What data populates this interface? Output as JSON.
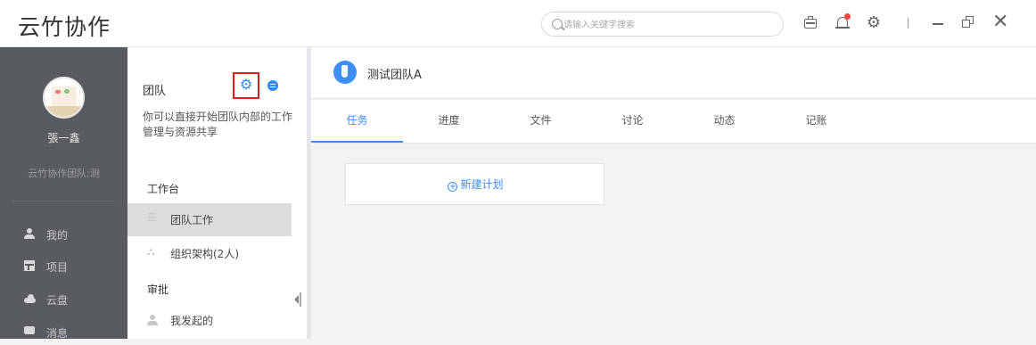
{
  "app": {
    "title": "云竹协作"
  },
  "search": {
    "placeholder": "请输入关键字搜索"
  },
  "titlebar": {
    "icons": [
      "briefcase-icon",
      "bell-icon",
      "gear-icon",
      "minimize-icon",
      "restore-icon",
      "close-icon"
    ],
    "notification_dot_color": "#f0483e"
  },
  "user": {
    "name": "張一鑫",
    "team": "云竹协作团队;测"
  },
  "leftnav": {
    "items": [
      {
        "label": "我的",
        "icon": "user-icon"
      },
      {
        "label": "项目",
        "icon": "project-icon"
      },
      {
        "label": "云盘",
        "icon": "cloud-icon"
      },
      {
        "label": "消息",
        "icon": "message-icon"
      }
    ]
  },
  "teampanel": {
    "title": "团队",
    "description": "你可以直接开始团队内部的工作管理与资源共享",
    "sections": {
      "workbench": "工作台",
      "approval": "审批"
    },
    "items": {
      "team_work": "团队工作",
      "org": "组织架构(2人)",
      "my_initiated": "我发起的"
    }
  },
  "main": {
    "team_name": "测试团队A",
    "tabs": [
      {
        "label": "任务",
        "active": true
      },
      {
        "label": "进度"
      },
      {
        "label": "文件"
      },
      {
        "label": "讨论"
      },
      {
        "label": "动态"
      },
      {
        "label": "记账"
      }
    ],
    "new_plan_label": "新建计划",
    "accent_color": "#3d8ef5"
  }
}
